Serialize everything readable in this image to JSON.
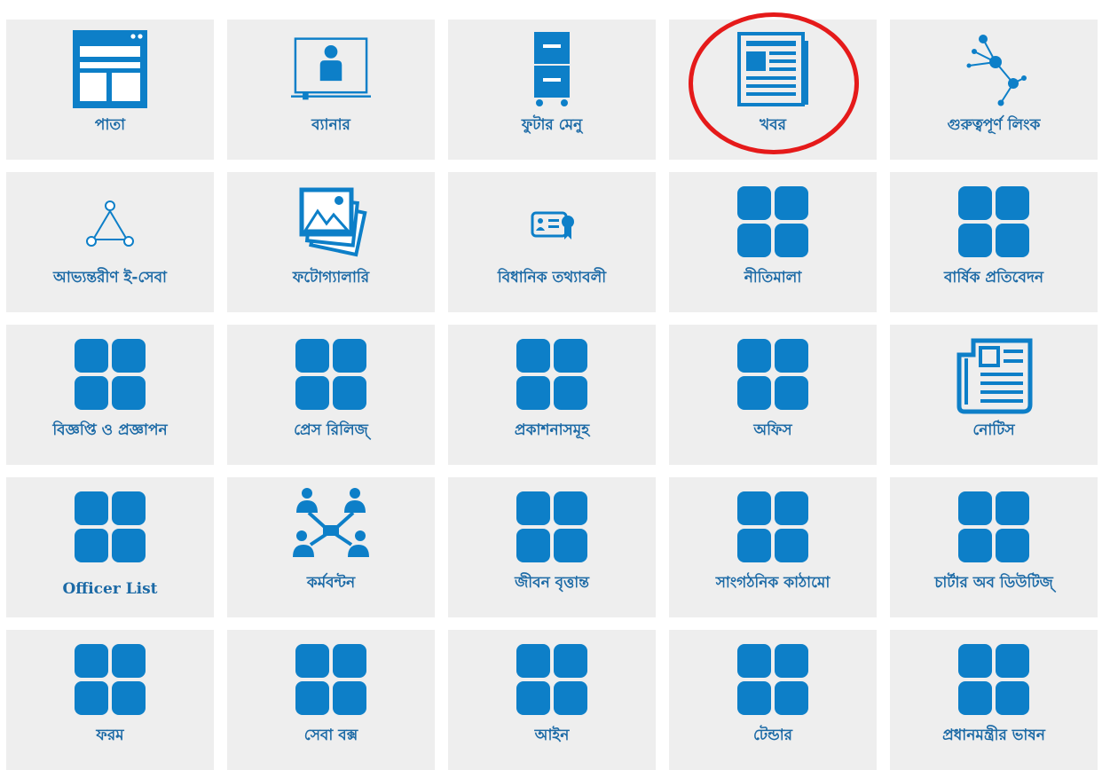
{
  "colors": {
    "accent": "#0d7fc8",
    "label": "#1c6aa6",
    "tile_bg": "#eeeeee",
    "highlight": "#e51a1a"
  },
  "tiles": [
    {
      "label": "পাতা",
      "icon": "page-layout-icon"
    },
    {
      "label": "ব্যানার",
      "icon": "banner-monitor-icon"
    },
    {
      "label": "ফুটার মেনু",
      "icon": "file-cabinet-icon"
    },
    {
      "label": "খবর",
      "icon": "newspaper-icon"
    },
    {
      "label": "গুরুত্বপূর্ণ লিংক",
      "icon": "network-nodes-icon"
    },
    {
      "label": "আভ্যন্তরীণ ই-সেবা",
      "icon": "triangle-nodes-icon"
    },
    {
      "label": "ফটোগ্যালারি",
      "icon": "photo-stack-icon"
    },
    {
      "label": "বিধানিক তথ্যাবলী",
      "icon": "certificate-card-icon"
    },
    {
      "label": "নীতিমালা",
      "icon": "grid-squares-icon"
    },
    {
      "label": "বার্ষিক প্রতিবেদন",
      "icon": "grid-squares-icon"
    },
    {
      "label": "বিজ্ঞপ্তি ও প্রজ্ঞাপন",
      "icon": "grid-squares-icon"
    },
    {
      "label": "প্রেস রিলিজ্",
      "icon": "grid-squares-icon"
    },
    {
      "label": "প্রকাশনাসমূহ",
      "icon": "grid-squares-icon"
    },
    {
      "label": "অফিস",
      "icon": "grid-squares-icon"
    },
    {
      "label": "নোটিস",
      "icon": "notice-newspaper-icon"
    },
    {
      "label": "Officer List",
      "icon": "grid-squares-icon"
    },
    {
      "label": "কর্মবন্টন",
      "icon": "people-network-icon"
    },
    {
      "label": "জীবন বৃত্তান্ত",
      "icon": "grid-squares-icon"
    },
    {
      "label": "সাংগঠনিক কাঠামো",
      "icon": "grid-squares-icon"
    },
    {
      "label": "চার্টার অব ডিউটিজ্",
      "icon": "grid-squares-icon"
    },
    {
      "label": "ফরম",
      "icon": "grid-squares-icon"
    },
    {
      "label": "সেবা বক্স",
      "icon": "grid-squares-icon"
    },
    {
      "label": "আইন",
      "icon": "grid-squares-icon"
    },
    {
      "label": "টেন্ডার",
      "icon": "grid-squares-icon"
    },
    {
      "label": "প্রধানমন্ত্রীর ভাষন",
      "icon": "grid-squares-icon"
    }
  ]
}
